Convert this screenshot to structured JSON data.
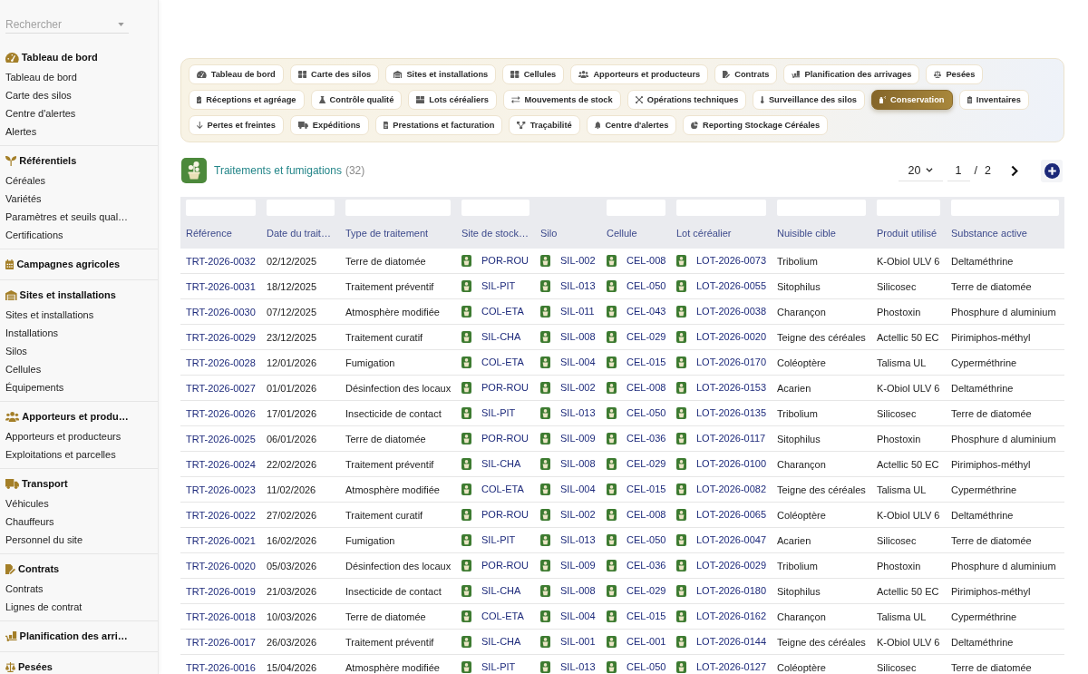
{
  "sidebar": {
    "search": {
      "placeholder": "Rechercher"
    },
    "sections": [
      {
        "title": "Tableau de bord",
        "items": [
          "Tableau de bord",
          "Carte des silos",
          "Centre d'alertes",
          "Alertes"
        ]
      },
      {
        "title": "Référentiels",
        "items": [
          "Céréales",
          "Variétés",
          "Paramètres et seuils qual…",
          "Certifications"
        ]
      },
      {
        "title": "Campagnes agricoles"
      },
      {
        "title": "Sites et installations",
        "items": [
          "Sites et installations",
          "Installations",
          "Silos",
          "Cellules",
          "Équipements"
        ]
      },
      {
        "title": "Apporteurs et produ…",
        "items": [
          "Apporteurs et producteurs",
          "Exploitations et parcelles"
        ]
      },
      {
        "title": "Transport",
        "items": [
          "Véhicules",
          "Chauffeurs",
          "Personnel du site"
        ]
      },
      {
        "title": "Contrats",
        "items": [
          "Contrats",
          "Lignes de contrat"
        ]
      },
      {
        "title": "Planification des arri…"
      },
      {
        "title": "Pesées"
      }
    ]
  },
  "tabs": [
    {
      "label": "Tableau de bord",
      "selected": false
    },
    {
      "label": "Carte des silos",
      "selected": false
    },
    {
      "label": "Sites et installations",
      "selected": false
    },
    {
      "label": "Cellules",
      "selected": false
    },
    {
      "label": "Apporteurs et producteurs",
      "selected": false
    },
    {
      "label": "Contrats",
      "selected": false
    },
    {
      "label": "Planification des arrivages",
      "selected": false
    },
    {
      "label": "Pesées",
      "selected": false
    },
    {
      "label": "Réceptions et agréage",
      "selected": false
    },
    {
      "label": "Contrôle qualité",
      "selected": false
    },
    {
      "label": "Lots céréaliers",
      "selected": false
    },
    {
      "label": "Mouvements de stock",
      "selected": false
    },
    {
      "label": "Opérations techniques",
      "selected": false
    },
    {
      "label": "Surveillance des silos",
      "selected": false
    },
    {
      "label": "Conservation",
      "selected": true
    },
    {
      "label": "Inventaires",
      "selected": false
    },
    {
      "label": "Pertes et freintes",
      "selected": false
    },
    {
      "label": "Expéditions",
      "selected": false
    },
    {
      "label": "Prestations et facturation",
      "selected": false
    },
    {
      "label": "Traçabilité",
      "selected": false
    },
    {
      "label": "Centre d'alertes",
      "selected": false
    },
    {
      "label": "Reporting Stockage Céréales",
      "selected": false
    }
  ],
  "header": {
    "title": "Traitements et fumigations",
    "count": "(32)"
  },
  "pagination": {
    "page_size": "20",
    "page": "1",
    "separator": "/",
    "total_pages": "2"
  },
  "table": {
    "columns": [
      {
        "label": "Référence",
        "kind": "link",
        "filter": true
      },
      {
        "label": "Date du trait…",
        "kind": "text",
        "filter": true
      },
      {
        "label": "Type de traitement",
        "kind": "text",
        "filter": true
      },
      {
        "label": "Site de stock…",
        "kind": "icon_link",
        "filter": true
      },
      {
        "label": "Silo",
        "kind": "icon_link",
        "filter": false
      },
      {
        "label": "Cellule",
        "kind": "icon_link",
        "filter": true
      },
      {
        "label": "Lot céréalier",
        "kind": "icon_link",
        "filter": true
      },
      {
        "label": "Nuisible cible",
        "kind": "text",
        "filter": true
      },
      {
        "label": "Produit utilisé",
        "kind": "text",
        "filter": true
      },
      {
        "label": "Substance active",
        "kind": "text",
        "filter": true
      }
    ],
    "rows": [
      [
        "TRT-2026-0032",
        "02/12/2025",
        "Terre de diatomée",
        "POR-ROU",
        "SIL-002",
        "CEL-008",
        "LOT-2026-0073",
        "Tribolium",
        "K-Obiol ULV 6",
        "Deltaméthrine"
      ],
      [
        "TRT-2026-0031",
        "18/12/2025",
        "Traitement préventif",
        "SIL-PIT",
        "SIL-013",
        "CEL-050",
        "LOT-2026-0055",
        "Sitophilus",
        "Silicosec",
        "Terre de diatomée"
      ],
      [
        "TRT-2026-0030",
        "07/12/2025",
        "Atmosphère modifiée",
        "COL-ETA",
        "SIL-011",
        "CEL-043",
        "LOT-2026-0038",
        "Charançon",
        "Phostoxin",
        "Phosphure d aluminium"
      ],
      [
        "TRT-2026-0029",
        "23/12/2025",
        "Traitement curatif",
        "SIL-CHA",
        "SIL-008",
        "CEL-029",
        "LOT-2026-0020",
        "Teigne des céréales",
        "Actellic 50 EC",
        "Pirimiphos-méthyl"
      ],
      [
        "TRT-2026-0028",
        "12/01/2026",
        "Fumigation",
        "COL-ETA",
        "SIL-004",
        "CEL-015",
        "LOT-2026-0170",
        "Coléoptère",
        "Talisma UL",
        "Cyperméthrine"
      ],
      [
        "TRT-2026-0027",
        "01/01/2026",
        "Désinfection des locaux",
        "POR-ROU",
        "SIL-002",
        "CEL-008",
        "LOT-2026-0153",
        "Acarien",
        "K-Obiol ULV 6",
        "Deltaméthrine"
      ],
      [
        "TRT-2026-0026",
        "17/01/2026",
        "Insecticide de contact",
        "SIL-PIT",
        "SIL-013",
        "CEL-050",
        "LOT-2026-0135",
        "Tribolium",
        "Silicosec",
        "Terre de diatomée"
      ],
      [
        "TRT-2026-0025",
        "06/01/2026",
        "Terre de diatomée",
        "POR-ROU",
        "SIL-009",
        "CEL-036",
        "LOT-2026-0117",
        "Sitophilus",
        "Phostoxin",
        "Phosphure d aluminium"
      ],
      [
        "TRT-2026-0024",
        "22/02/2026",
        "Traitement préventif",
        "SIL-CHA",
        "SIL-008",
        "CEL-029",
        "LOT-2026-0100",
        "Charançon",
        "Actellic 50 EC",
        "Pirimiphos-méthyl"
      ],
      [
        "TRT-2026-0023",
        "11/02/2026",
        "Atmosphère modifiée",
        "COL-ETA",
        "SIL-004",
        "CEL-015",
        "LOT-2026-0082",
        "Teigne des céréales",
        "Talisma UL",
        "Cyperméthrine"
      ],
      [
        "TRT-2026-0022",
        "27/02/2026",
        "Traitement curatif",
        "POR-ROU",
        "SIL-002",
        "CEL-008",
        "LOT-2026-0065",
        "Coléoptère",
        "K-Obiol ULV 6",
        "Deltaméthrine"
      ],
      [
        "TRT-2026-0021",
        "16/02/2026",
        "Fumigation",
        "SIL-PIT",
        "SIL-013",
        "CEL-050",
        "LOT-2026-0047",
        "Acarien",
        "Silicosec",
        "Terre de diatomée"
      ],
      [
        "TRT-2026-0020",
        "05/03/2026",
        "Désinfection des locaux",
        "POR-ROU",
        "SIL-009",
        "CEL-036",
        "LOT-2026-0029",
        "Tribolium",
        "Phostoxin",
        "Phosphure d aluminium"
      ],
      [
        "TRT-2026-0019",
        "21/03/2026",
        "Insecticide de contact",
        "SIL-CHA",
        "SIL-008",
        "CEL-029",
        "LOT-2026-0180",
        "Sitophilus",
        "Actellic 50 EC",
        "Pirimiphos-méthyl"
      ],
      [
        "TRT-2026-0018",
        "10/03/2026",
        "Terre de diatomée",
        "COL-ETA",
        "SIL-004",
        "CEL-015",
        "LOT-2026-0162",
        "Charançon",
        "Talisma UL",
        "Cyperméthrine"
      ],
      [
        "TRT-2026-0017",
        "26/03/2026",
        "Traitement préventif",
        "SIL-CHA",
        "SIL-001",
        "CEL-001",
        "LOT-2026-0144",
        "Teigne des céréales",
        "K-Obiol ULV 6",
        "Deltaméthrine"
      ],
      [
        "TRT-2026-0016",
        "15/04/2026",
        "Atmosphère modifiée",
        "SIL-PIT",
        "SIL-013",
        "CEL-050",
        "LOT-2026-0127",
        "Coléoptère",
        "Silicosec",
        "Terre de diatomée"
      ]
    ]
  }
}
